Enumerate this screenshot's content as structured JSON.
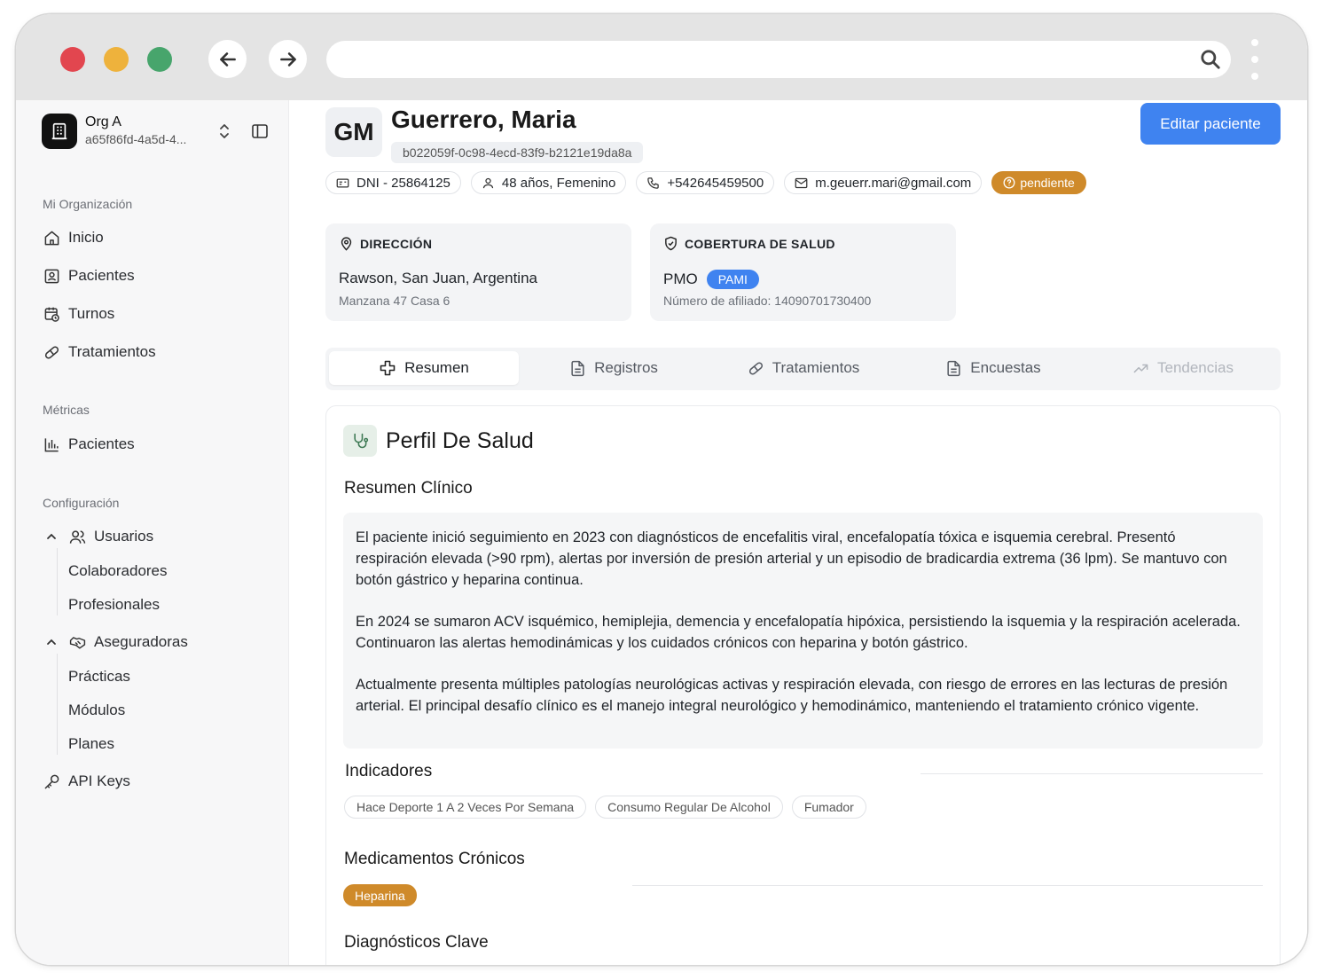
{
  "browser": {
    "url": ""
  },
  "org": {
    "name": "Org A",
    "id": "a65f86fd-4a5d-4..."
  },
  "sidebar": {
    "section_org": "Mi Organización",
    "items": [
      {
        "label": "Inicio",
        "icon": "home-icon"
      },
      {
        "label": "Pacientes",
        "icon": "patient-card-icon"
      },
      {
        "label": "Turnos",
        "icon": "calendar-clock-icon"
      },
      {
        "label": "Tratamientos",
        "icon": "pill-icon"
      }
    ],
    "section_metrics": "Métricas",
    "metrics_items": [
      {
        "label": "Pacientes",
        "icon": "bar-chart-icon"
      }
    ],
    "section_config": "Configuración",
    "usuarios": {
      "label": "Usuarios",
      "children": [
        "Colaboradores",
        "Profesionales"
      ]
    },
    "aseguradoras": {
      "label": "Aseguradoras",
      "children": [
        "Prácticas",
        "Módulos",
        "Planes"
      ]
    },
    "api_keys": "API Keys"
  },
  "patient": {
    "initials": "GM",
    "name": "Guerrero, Maria",
    "uuid": "b022059f-0c98-4ecd-83f9-b2121e19da8a",
    "edit_label": "Editar paciente",
    "dni": "DNI - 25864125",
    "age_sex": "48 años, Femenino",
    "phone": "+542645459500",
    "email": "m.geuerr.mari@gmail.com",
    "status": "pendiente"
  },
  "address": {
    "heading": "DIRECCIÓN",
    "main": "Rawson, San Juan, Argentina",
    "sub": "Manzana 47 Casa 6"
  },
  "coverage": {
    "heading": "COBERTURA DE SALUD",
    "plan": "PMO",
    "badge": "PAMI",
    "affiliate": "Número de afiliado: 14090701730400"
  },
  "tabs": [
    {
      "label": "Resumen",
      "state": "active"
    },
    {
      "label": "Registros",
      "state": "normal"
    },
    {
      "label": "Tratamientos",
      "state": "normal"
    },
    {
      "label": "Encuestas",
      "state": "normal"
    },
    {
      "label": "Tendencias",
      "state": "disabled"
    }
  ],
  "profile": {
    "title": "Perfil De Salud",
    "clinical_summary_title": "Resumen Clínico",
    "paragraphs": [
      "El paciente inició seguimiento en 2023 con diagnósticos de encefalitis viral, encefalopatía tóxica e isquemia cerebral. Presentó respiración elevada (>90 rpm), alertas por inversión de presión arterial y un episodio de bradicardia extrema (36 lpm). Se mantuvo con botón gástrico y heparina continua.",
      "En 2024 se sumaron ACV isquémico, hemiplejia, demencia y encefalopatía hipóxica, persistiendo la isquemia y la respiración acelerada. Continuaron las alertas hemodinámicas y los cuidados crónicos con heparina y botón gástrico.",
      "Actualmente presenta múltiples patologías neurológicas activas y respiración elevada, con riesgo de errores en las lecturas de presión arterial. El principal desafío clínico es el manejo integral neurológico y hemodinámico, manteniendo el tratamiento crónico vigente."
    ],
    "indicators_title": "Indicadores",
    "indicators": [
      "Hace Deporte 1 A 2 Veces Por Semana",
      "Consumo Regular De Alcohol",
      "Fumador"
    ],
    "meds_title": "Medicamentos Crónicos",
    "meds": [
      "Heparina"
    ],
    "diagnoses_title": "Diagnósticos Clave"
  },
  "colors": {
    "accent": "#3f83f0",
    "pending": "#cf8a2a",
    "sidebar_bg": "#f7f7f8"
  }
}
